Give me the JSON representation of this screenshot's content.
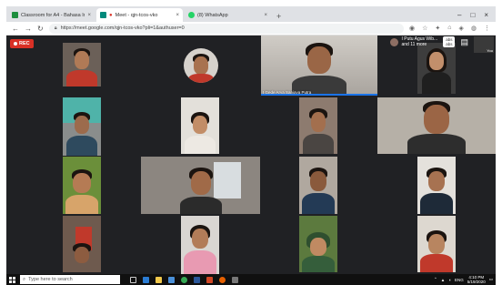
{
  "browser": {
    "tabs": [
      {
        "label": "Classroom for A4 - Bahasa Inggr",
        "favicon_color": "#1e8e3e",
        "active": false
      },
      {
        "label": "Meet - qjn-tcos-vko",
        "favicon_color": "#00897b",
        "active": true
      },
      {
        "label": "(8) WhatsApp",
        "favicon_color": "#25d366",
        "active": false
      }
    ],
    "new_tab": "+",
    "window_controls": [
      "–",
      "□",
      "×"
    ],
    "address": {
      "url": "https://meet.google.com/qjn-tcos-vko?pli=1&authuser=0",
      "lock_icon": "lock-icon"
    }
  },
  "meet": {
    "recording_label": "REC",
    "active_speaker_name": "I Gede Arya Sanjaya Putra",
    "others_label_line1": "I Putu Agus Wib...",
    "others_label_line2": "and 11 more",
    "badge_line1": "abs",
    "badge_line2": "abs",
    "self_label": "You",
    "accent_color": "#1a73e8",
    "recording_color": "#d93025"
  },
  "taskbar": {
    "search_placeholder": "Type here to search",
    "time": "4:10 PM",
    "date": "5/19/2020",
    "language": "ENG"
  }
}
